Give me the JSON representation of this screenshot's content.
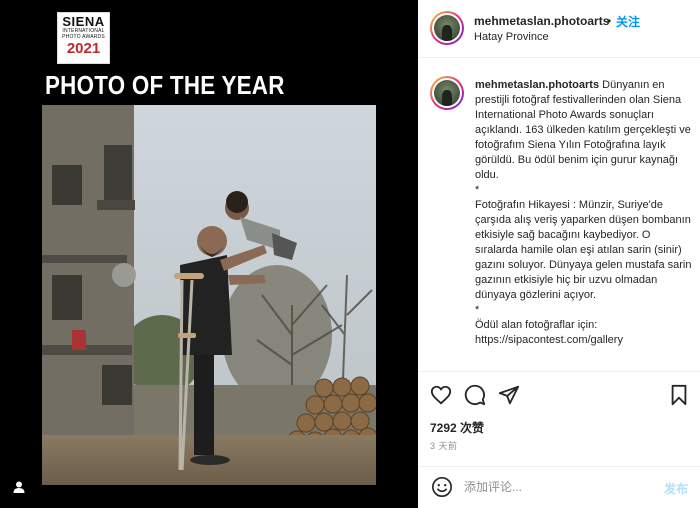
{
  "media": {
    "logo": {
      "line1": "SIENA",
      "line2a": "INTERNATIONAL",
      "line2b": "PHOTO AWARDS",
      "line3": "2021"
    },
    "title": "PHOTO OF THE YEAR",
    "icons": {
      "user": "user-icon"
    }
  },
  "header": {
    "username": "mehmetaslan.photoarts",
    "separator": "•",
    "follow": "关注",
    "location": "Hatay Province"
  },
  "caption": {
    "username": "mehmetaslan.photoarts",
    "first_line": "Dünyanın en prestijli fotoğraf festivallerinden olan Siena International Photo Awards sonuçları açıklandı. 163 ülkeden katılım gerçekleşti ve fotoğrafım Siena Yılın Fotoğrafına layık görüldü. Bu ödül benim için gurur kaynağı oldu.",
    "paragraphs": [
      "*",
      "Fotoğrafın Hikayesi : Münzir, Suriye'de çarşıda alış veriş yaparken düşen bombanın etkisiyle sağ bacağını kaybediyor. O sıralarda hamile olan eşi atılan sarin (sinir) gazını soluyor. Dünyaya gelen mustafa sarin gazının etkisiyle hiç bir uzvu olmadan dünyaya gözlerini açıyor.",
      "*",
      "Ödül alan fotoğraflar için:",
      "https://sipacontest.com/gallery"
    ]
  },
  "actions": {
    "icons": [
      "heart-icon",
      "comment-icon",
      "share-icon",
      "bookmark-icon"
    ],
    "likes": "7292 次赞",
    "time": "3 天前"
  },
  "comment": {
    "placeholder": "添加评论...",
    "post": "发布",
    "icon": "emoji-icon"
  },
  "colors": {
    "link": "#0095f6",
    "post_disabled": "#b2dffc",
    "logo_red": "#c0282d",
    "media_bg": "#000000"
  }
}
